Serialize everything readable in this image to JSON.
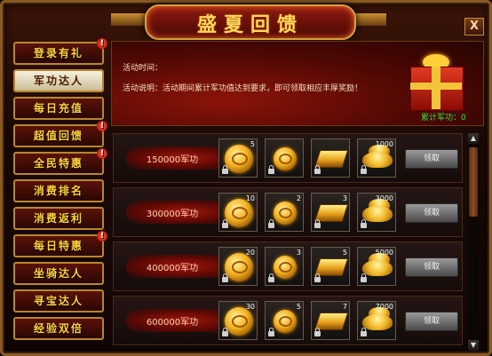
{
  "window": {
    "title": "盛夏回馈",
    "close_label": "X"
  },
  "sidebar": {
    "items": [
      {
        "label": "登录有礼",
        "badge": "!"
      },
      {
        "label": "军功达人",
        "badge": ""
      },
      {
        "label": "每日充值",
        "badge": ""
      },
      {
        "label": "超值回馈",
        "badge": "!"
      },
      {
        "label": "全民特惠",
        "badge": "!"
      },
      {
        "label": "消费排名",
        "badge": ""
      },
      {
        "label": "消费返利",
        "badge": ""
      },
      {
        "label": "每日特惠",
        "badge": "!"
      },
      {
        "label": "坐骑达人",
        "badge": ""
      },
      {
        "label": "寻宝达人",
        "badge": ""
      },
      {
        "label": "经验双倍",
        "badge": ""
      }
    ],
    "active_index": 1
  },
  "banner": {
    "time_label": "活动时间：",
    "desc_label": "活动说明：活动期间累计军功值达到要求，即可领取相应丰厚奖励！",
    "merit_label": "累计军功：0"
  },
  "rewards": [
    {
      "requirement": "150000军功",
      "counts": [
        "5",
        "",
        "",
        "1000"
      ],
      "claim_label": "领取"
    },
    {
      "requirement": "300000军功",
      "counts": [
        "10",
        "2",
        "3",
        "3000"
      ],
      "claim_label": "领取"
    },
    {
      "requirement": "400000军功",
      "counts": [
        "20",
        "3",
        "5",
        "5000"
      ],
      "claim_label": "领取"
    },
    {
      "requirement": "600000军功",
      "counts": [
        "30",
        "5",
        "7",
        "7000"
      ],
      "claim_label": "领取"
    }
  ],
  "item_icons": [
    "gold-medal-icon",
    "gold-orb-icon",
    "gold-bar-icon",
    "gold-ingot-icon"
  ],
  "colors": {
    "accent_gold": "#ffd33a",
    "frame_red": "#5a1209",
    "merit_green": "#34e23a"
  }
}
